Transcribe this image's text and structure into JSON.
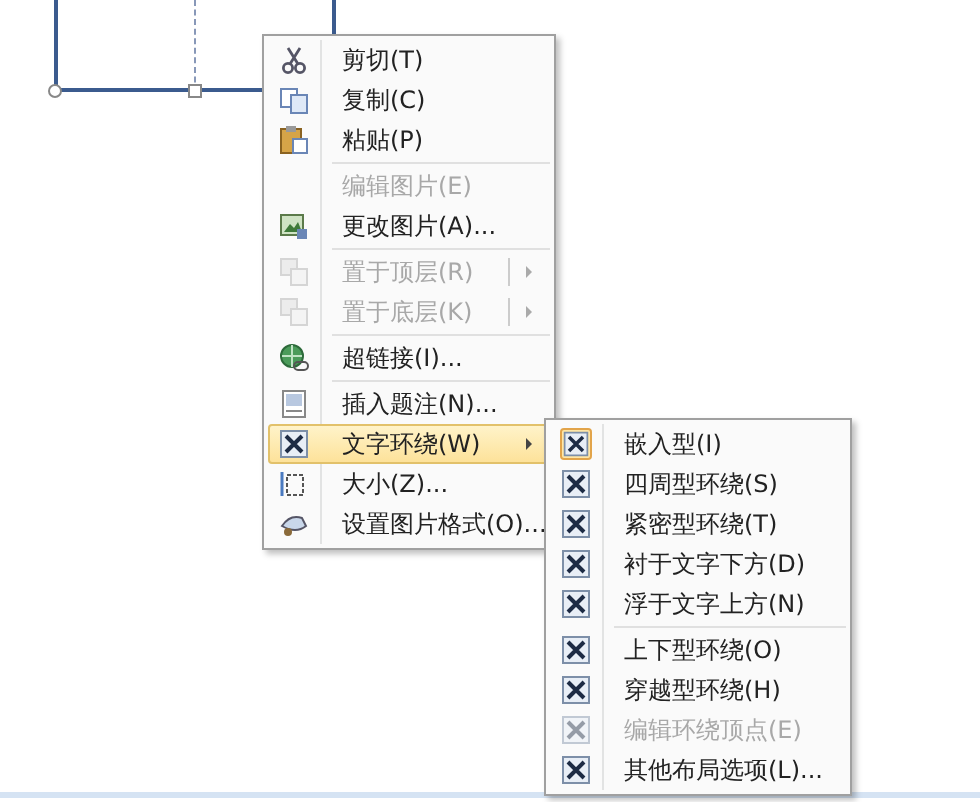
{
  "context_menu": {
    "items": [
      {
        "kind": "item",
        "label": "剪切(T)",
        "disabled": false,
        "submenu": false,
        "highlighted": false
      },
      {
        "kind": "item",
        "label": "复制(C)",
        "disabled": false,
        "submenu": false,
        "highlighted": false
      },
      {
        "kind": "item",
        "label": "粘贴(P)",
        "disabled": false,
        "submenu": false,
        "highlighted": false
      },
      {
        "kind": "separator"
      },
      {
        "kind": "item",
        "label": "编辑图片(E)",
        "disabled": true,
        "submenu": false,
        "highlighted": false
      },
      {
        "kind": "item",
        "label": "更改图片(A)...",
        "disabled": false,
        "submenu": false,
        "highlighted": false
      },
      {
        "kind": "separator"
      },
      {
        "kind": "item",
        "label": "置于顶层(R)",
        "disabled": true,
        "submenu": true,
        "highlighted": false
      },
      {
        "kind": "item",
        "label": "置于底层(K)",
        "disabled": true,
        "submenu": true,
        "highlighted": false
      },
      {
        "kind": "separator"
      },
      {
        "kind": "item",
        "label": "超链接(I)...",
        "disabled": false,
        "submenu": false,
        "highlighted": false
      },
      {
        "kind": "separator"
      },
      {
        "kind": "item",
        "label": "插入题注(N)...",
        "disabled": false,
        "submenu": false,
        "highlighted": false
      },
      {
        "kind": "item",
        "label": "文字环绕(W)",
        "disabled": false,
        "submenu": true,
        "highlighted": true
      },
      {
        "kind": "item",
        "label": "大小(Z)...",
        "disabled": false,
        "submenu": false,
        "highlighted": false
      },
      {
        "kind": "item",
        "label": "设置图片格式(O)...",
        "disabled": false,
        "submenu": false,
        "highlighted": false
      }
    ]
  },
  "wrap_submenu": {
    "items": [
      {
        "kind": "item",
        "label": "嵌入型(I)",
        "selected": true,
        "disabled": false
      },
      {
        "kind": "item",
        "label": "四周型环绕(S)",
        "selected": false,
        "disabled": false
      },
      {
        "kind": "item",
        "label": "紧密型环绕(T)",
        "selected": false,
        "disabled": false
      },
      {
        "kind": "item",
        "label": "衬于文字下方(D)",
        "selected": false,
        "disabled": false
      },
      {
        "kind": "item",
        "label": "浮于文字上方(N)",
        "selected": false,
        "disabled": false
      },
      {
        "kind": "separator"
      },
      {
        "kind": "item",
        "label": "上下型环绕(O)",
        "selected": false,
        "disabled": false
      },
      {
        "kind": "item",
        "label": "穿越型环绕(H)",
        "selected": false,
        "disabled": false
      },
      {
        "kind": "item",
        "label": "编辑环绕顶点(E)",
        "selected": false,
        "disabled": true
      },
      {
        "kind": "item",
        "label": "其他布局选项(L)...",
        "selected": false,
        "disabled": false
      }
    ]
  }
}
